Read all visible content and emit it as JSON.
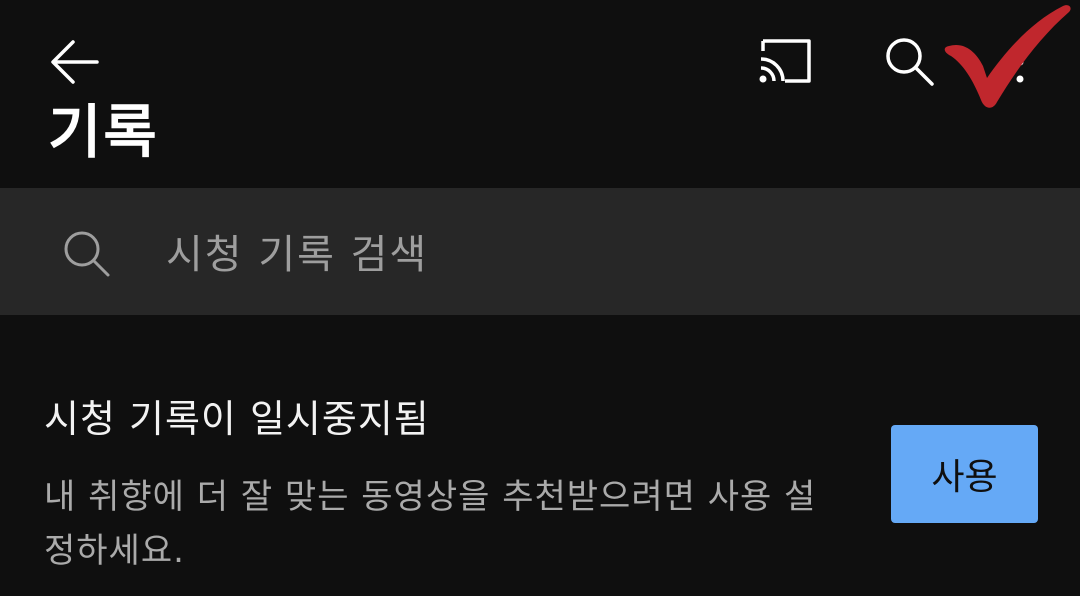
{
  "header": {
    "title": "기록",
    "back_icon": "arrow-left-icon",
    "cast_icon": "cast-icon",
    "search_icon": "search-icon",
    "more_icon": "more-vertical-icon"
  },
  "search": {
    "placeholder": "시청 기록 검색",
    "icon": "search-icon"
  },
  "history_paused": {
    "title": "시청 기록이 일시중지됨",
    "description": "내 취향에 더 잘 맞는 동영상을 추천받으려면 사용 설정하세요.",
    "button_label": "사용"
  },
  "colors": {
    "background": "#0f0f0f",
    "search_bar": "#272727",
    "button": "#65a9f6",
    "annotation_check": "#c0272d"
  }
}
